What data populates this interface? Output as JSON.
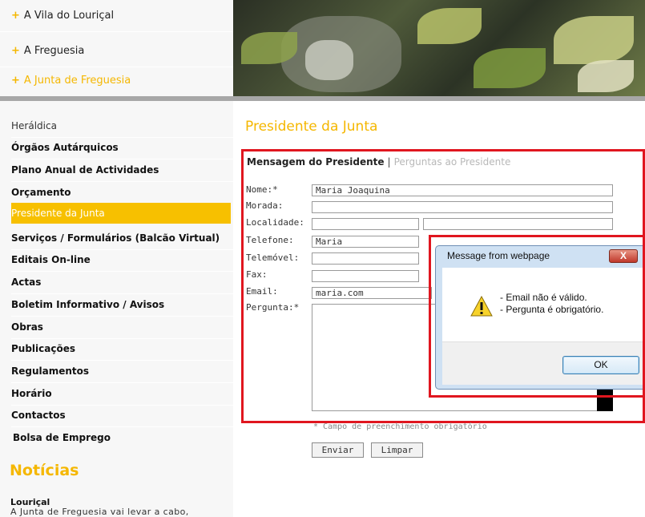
{
  "top_nav": {
    "items": [
      {
        "label": "A Vila do Louriçal"
      },
      {
        "label": "A Freguesia"
      },
      {
        "label": "A Junta de Freguesia"
      }
    ],
    "plus_symbol": "+"
  },
  "sidebar": {
    "items": [
      {
        "label": "Heráldica"
      },
      {
        "label": "Órgãos Autárquicos"
      },
      {
        "label": "Plano Anual de Actividades"
      },
      {
        "label": "Orçamento"
      },
      {
        "label": "Presidente da Junta"
      },
      {
        "label": "Serviços / Formulários (Balcão Virtual)"
      },
      {
        "label": "Editais On-line"
      },
      {
        "label": "Actas"
      },
      {
        "label": "Boletim Informativo / Avisos"
      },
      {
        "label": "Obras"
      },
      {
        "label": "Publicações"
      },
      {
        "label": "Regulamentos"
      },
      {
        "label": "Horário"
      },
      {
        "label": "Contactos"
      },
      {
        "label": "Bolsa de Emprego"
      }
    ],
    "news": {
      "title": "Notícias",
      "headline": "Louriçal",
      "text": "A Junta de Freguesia vai levar a cabo,"
    }
  },
  "main": {
    "title": "Presidente da Junta",
    "tabs": {
      "active": "Mensagem do Presidente",
      "separator": "|",
      "inactive": "Perguntas ao Presidente"
    },
    "form": {
      "labels": {
        "nome": "Nome:*",
        "morada": "Morada:",
        "localidade": "Localidade:",
        "telefone": "Telefone:",
        "telemovel": "Telemóvel:",
        "fax": "Fax:",
        "email": "Email:",
        "pergunta": "Pergunta:*"
      },
      "values": {
        "nome": "Maria Joaquina",
        "morada": "",
        "localidade_1": "",
        "localidade_2": "",
        "telefone": "Maria",
        "telemovel": "",
        "fax": "",
        "email": "maria.com",
        "pergunta": ""
      },
      "footnote": "* Campo de preenchimento obrigatório",
      "submit_label": "Enviar",
      "reset_label": "Limpar"
    }
  },
  "dialog": {
    "title": "Message from webpage",
    "close_symbol": "X",
    "icon": "warning-icon",
    "messages": [
      "- Email não é válido.",
      "- Pergunta é obrigatório."
    ],
    "ok_label": "OK"
  },
  "colors": {
    "accent": "#f5b700",
    "highlight_border": "#e0161f",
    "dialog_frame": "#cfe1f3"
  }
}
